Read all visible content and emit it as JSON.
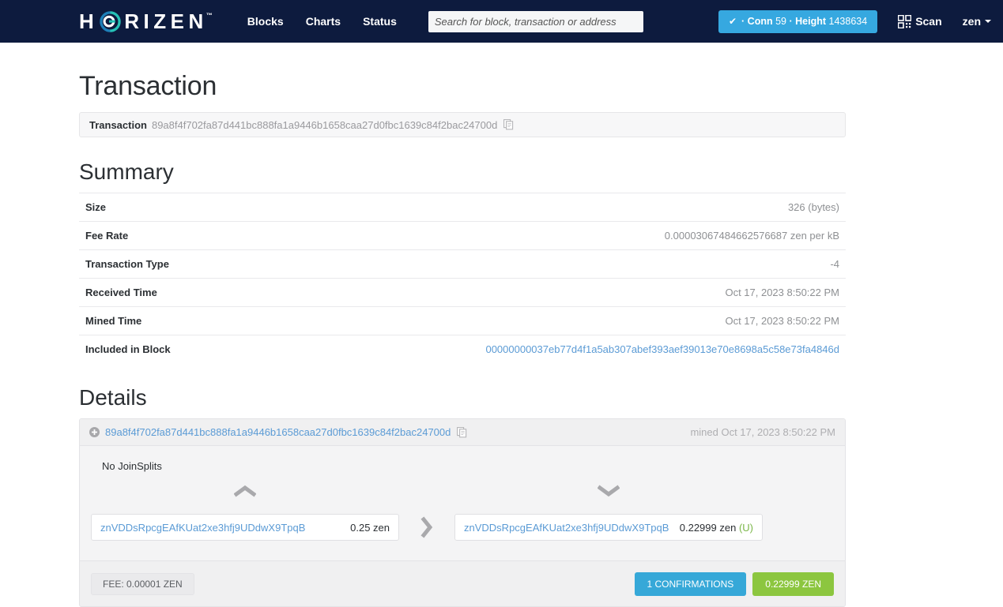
{
  "navbar": {
    "brand": {
      "pre": "H",
      "post": "RIZEN",
      "tm": "™",
      "logo_icon": "horizen-swirl-icon"
    },
    "links": [
      {
        "label": "Blocks"
      },
      {
        "label": "Charts"
      },
      {
        "label": "Status"
      }
    ],
    "search": {
      "placeholder": "Search for block, transaction or address",
      "value": ""
    },
    "status": {
      "check": "✔",
      "conn_label": "· Conn",
      "conn_value": "59",
      "height_label": "· Height",
      "height_value": "1438634",
      "color": "#36a8e0"
    },
    "scan": {
      "label": "Scan",
      "icon": "qr-code-icon"
    },
    "network": {
      "label": "zen",
      "icon": "chevron-down-icon"
    }
  },
  "page": {
    "title": "Transaction",
    "tx_bar": {
      "label": "Transaction",
      "hash": "89a8f4f702fa87d441bc888fa1a9446b1658caa27d0fbc1639c84f2bac24700d",
      "copy_icon": "copy-icon"
    }
  },
  "summary": {
    "title": "Summary",
    "rows": [
      {
        "key": "Size",
        "value": "326 (bytes)",
        "link": false
      },
      {
        "key": "Fee Rate",
        "value": "0.00003067484662576687 zen per kB",
        "link": false
      },
      {
        "key": "Transaction Type",
        "value": "-4",
        "link": false
      },
      {
        "key": "Received Time",
        "value": "Oct 17, 2023 8:50:22 PM",
        "link": false
      },
      {
        "key": "Mined Time",
        "value": "Oct 17, 2023 8:50:22 PM",
        "link": false
      },
      {
        "key": "Included in Block",
        "value": "00000000037eb77d4f1a5ab307abef393aef39013e70e8698a5c58e73fa4846d",
        "link": true
      }
    ]
  },
  "details": {
    "title": "Details",
    "header": {
      "expand_icon": "circle-plus-icon",
      "hash": "89a8f4f702fa87d441bc888fa1a9446b1658caa27d0fbc1639c84f2bac24700d",
      "copy_icon": "copy-icon",
      "mined": "mined Oct 17, 2023 8:50:22 PM"
    },
    "joinsplits": "No JoinSplits",
    "inputs": {
      "chevron_icon": "chevron-up-icon",
      "items": [
        {
          "address": "znVDDsRpcgEAfKUat2xe3hfj9UDdwX9TpqB",
          "amount": "0.25 zen",
          "flag": ""
        }
      ]
    },
    "arrow_icon": "chevron-right-icon",
    "outputs": {
      "chevron_icon": "chevron-down-icon",
      "items": [
        {
          "address": "znVDDsRpcgEAfKUat2xe3hfj9UDdwX9TpqB",
          "amount": "0.22999 zen",
          "flag": "(U)"
        }
      ]
    },
    "footer": {
      "fee": "FEE: 0.00001 ZEN",
      "confirmations": "1 CONFIRMATIONS",
      "total": "0.22999 ZEN",
      "confirmations_color": "#36a8d8",
      "total_color": "#8cc63f"
    }
  }
}
